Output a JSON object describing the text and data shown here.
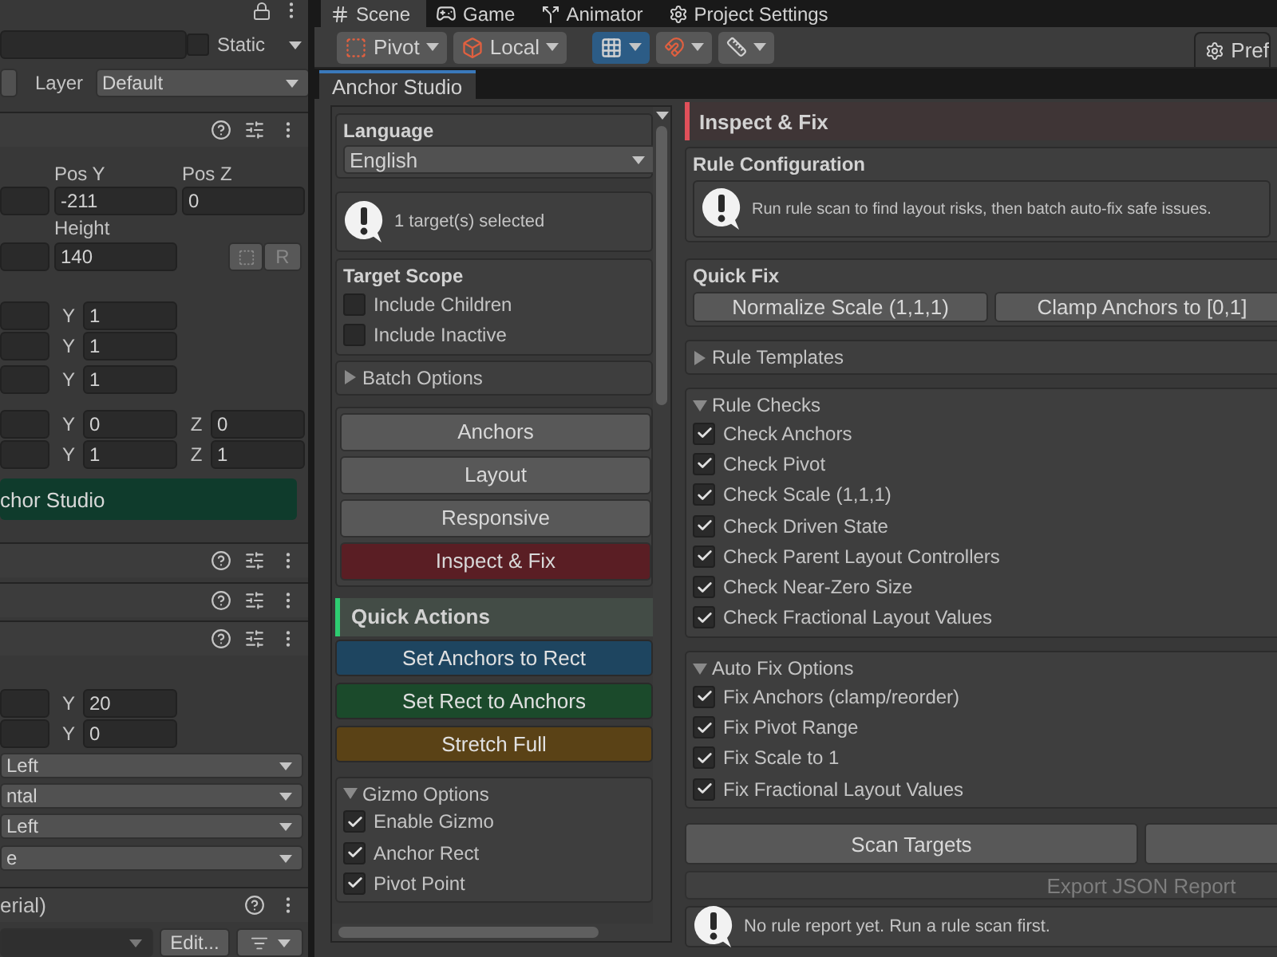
{
  "inspector": {
    "rows": [
      {
        "kind": "static",
        "label": "Static",
        "checked": false
      },
      {
        "kind": "layer",
        "label": "Layer",
        "value": "Default"
      },
      {
        "kind": "header"
      },
      {
        "kind": "labels",
        "labels": [
          "Pos Y",
          "Pos Z"
        ]
      },
      {
        "kind": "fields",
        "values": [
          "-211",
          "0"
        ]
      },
      {
        "kind": "labels",
        "labels": [
          "Height"
        ]
      },
      {
        "kind": "size",
        "values": [
          "140"
        ],
        "button": "R"
      },
      {
        "kind": "axes",
        "axes": [
          {
            "axis": "Y",
            "value": "1"
          }
        ]
      },
      {
        "kind": "axes",
        "axes": [
          {
            "axis": "Y",
            "value": "1"
          }
        ]
      },
      {
        "kind": "axes",
        "axes": [
          {
            "axis": "Y",
            "value": "1"
          }
        ]
      },
      {
        "kind": "axes",
        "axes": [
          {
            "axis": "Y",
            "value": "0"
          },
          {
            "axis": "Z",
            "value": "0"
          }
        ]
      },
      {
        "kind": "axes",
        "axes": [
          {
            "axis": "Y",
            "value": "1"
          },
          {
            "axis": "Z",
            "value": "1"
          }
        ]
      },
      {
        "kind": "component",
        "label": "chor Studio"
      },
      {
        "kind": "header"
      },
      {
        "kind": "header"
      },
      {
        "kind": "header"
      },
      {
        "kind": "axes",
        "axes": [
          {
            "axis": "Y",
            "value": "20"
          }
        ]
      },
      {
        "kind": "axes",
        "axes": [
          {
            "axis": "Y",
            "value": "0"
          }
        ]
      },
      {
        "kind": "dropdown",
        "value": "Left"
      },
      {
        "kind": "dropdown",
        "value": "ntal"
      },
      {
        "kind": "dropdown",
        "value": "Left"
      },
      {
        "kind": "dropdown",
        "value": "e"
      },
      {
        "kind": "header",
        "title": "erial)"
      },
      {
        "kind": "material",
        "button": "Edit..."
      }
    ]
  },
  "editor_tabs": [
    {
      "label": "Scene",
      "selected": true
    },
    {
      "label": "Game",
      "selected": false
    },
    {
      "label": "Animator",
      "selected": false
    },
    {
      "label": "Project Settings",
      "selected": false
    }
  ],
  "toolbar": {
    "pivot": "Pivot",
    "space": "Local",
    "grid_snap_on": true,
    "preferences": "Pref"
  },
  "window_tab": {
    "label": "Anchor Studio"
  },
  "sidebar": {
    "language": {
      "label": "Language",
      "value": "English"
    },
    "selection_info": "1 target(s) selected",
    "target_scope": {
      "title": "Target Scope",
      "options": [
        {
          "label": "Include Children",
          "checked": false
        },
        {
          "label": "Include Inactive",
          "checked": false
        }
      ]
    },
    "batch_options": {
      "label": "Batch Options",
      "expanded": false
    },
    "nav": [
      {
        "label": "Anchors",
        "selected": false
      },
      {
        "label": "Layout",
        "selected": false
      },
      {
        "label": "Responsive",
        "selected": false
      },
      {
        "label": "Inspect & Fix",
        "selected": true
      }
    ],
    "quick_actions": {
      "title": "Quick Actions",
      "buttons": [
        {
          "label": "Set Anchors to Rect",
          "color": "#1e4560"
        },
        {
          "label": "Set Rect to Anchors",
          "color": "#1b4a2b"
        },
        {
          "label": "Stretch Full",
          "color": "#5a4216"
        }
      ]
    },
    "gizmo_options": {
      "label": "Gizmo Options",
      "expanded": true,
      "options": [
        {
          "label": "Enable Gizmo",
          "checked": true
        },
        {
          "label": "Anchor Rect",
          "checked": true
        },
        {
          "label": "Pivot Point",
          "checked": true
        }
      ]
    }
  },
  "main": {
    "title": "Inspect & Fix",
    "rule_configuration": {
      "title": "Rule Configuration",
      "info": "Run rule scan to find layout risks, then batch auto-fix safe issues."
    },
    "quick_fix": {
      "title": "Quick Fix",
      "buttons": [
        "Normalize Scale (1,1,1)",
        "Clamp Anchors to [0,1]"
      ]
    },
    "sections": [
      {
        "title": "Rule Templates",
        "expanded": false
      },
      {
        "title": "Rule Checks",
        "expanded": true,
        "options": [
          {
            "label": "Check Anchors",
            "checked": true
          },
          {
            "label": "Check Pivot",
            "checked": true
          },
          {
            "label": "Check Scale (1,1,1)",
            "checked": true
          },
          {
            "label": "Check Driven State",
            "checked": true
          },
          {
            "label": "Check Parent Layout Controllers",
            "checked": true
          },
          {
            "label": "Check Near-Zero Size",
            "checked": true
          },
          {
            "label": "Check Fractional Layout Values",
            "checked": true
          }
        ]
      },
      {
        "title": "Auto Fix Options",
        "expanded": true,
        "options": [
          {
            "label": "Fix Anchors (clamp/reorder)",
            "checked": true
          },
          {
            "label": "Fix Pivot Range",
            "checked": true
          },
          {
            "label": "Fix Scale to 1",
            "checked": true
          },
          {
            "label": "Fix Fractional Layout Values",
            "checked": true
          }
        ]
      }
    ],
    "scan_button": "Scan Targets",
    "export_button": {
      "label": "Export JSON Report",
      "disabled": true
    },
    "report_info": "No rule report yet. Run a rule scan first."
  }
}
